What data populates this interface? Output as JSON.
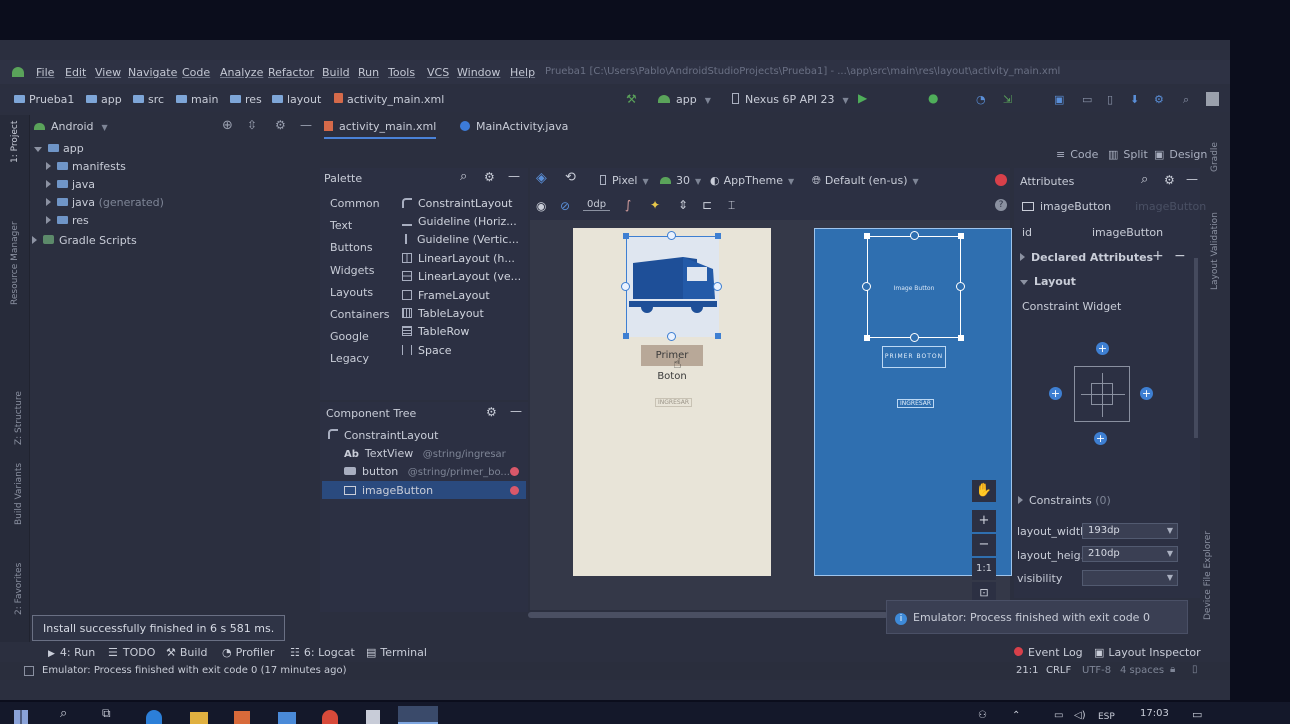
{
  "menu": [
    "File",
    "Edit",
    "View",
    "Navigate",
    "Code",
    "Analyze",
    "Refactor",
    "Build",
    "Run",
    "Tools",
    "VCS",
    "Window",
    "Help"
  ],
  "title": "Prueba1 [C:\\Users\\Pablo\\AndroidStudioProjects\\Prueba1] - ...\\app\\src\\main\\res\\layout\\activity_main.xml",
  "breadcrumbs": [
    "Prueba1",
    "app",
    "src",
    "main",
    "res",
    "layout",
    "activity_main.xml"
  ],
  "run_config": "app",
  "device": "Nexus 6P API 23",
  "project_view": "Android",
  "tabs": [
    "activity_main.xml",
    "MainActivity.java"
  ],
  "view_modes": [
    "Code",
    "Split",
    "Design"
  ],
  "project_tree": [
    {
      "label": "app",
      "level": 0,
      "open": true
    },
    {
      "label": "manifests",
      "level": 1
    },
    {
      "label": "java",
      "level": 1
    },
    {
      "label": "java",
      "suffix": "(generated)",
      "level": 1
    },
    {
      "label": "res",
      "level": 1
    },
    {
      "label": "Gradle Scripts",
      "level": 0
    }
  ],
  "side_tools": [
    "1: Project",
    "Resource Manager",
    "Z: Structure",
    "Build Variants",
    "2: Favorites"
  ],
  "right_tools": [
    "Gradle",
    "Layout Validation",
    "Device File Explorer"
  ],
  "palette": {
    "title": "Palette",
    "categories": [
      "Common",
      "Text",
      "Buttons",
      "Widgets",
      "Layouts",
      "Containers",
      "Google",
      "Legacy"
    ],
    "items": [
      "ConstraintLayout",
      "Guideline (Horiz...",
      "Guideline (Vertic...",
      "LinearLayout (h...",
      "LinearLayout (ve...",
      "FrameLayout",
      "TableLayout",
      "TableRow",
      "Space"
    ]
  },
  "design_toolbar": {
    "device": "Pixel",
    "api": "30",
    "theme": "AppTheme",
    "locale": "Default (en-us)",
    "margin": "0dp"
  },
  "component_tree": {
    "title": "Component Tree",
    "items": [
      {
        "label": "ConstraintLayout",
        "ref": "",
        "level": 0
      },
      {
        "label": "TextView",
        "ref": "@string/ingresar",
        "level": 1
      },
      {
        "label": "button",
        "ref": "@string/primer_bo...",
        "level": 1
      },
      {
        "label": "imageButton",
        "ref": "",
        "level": 1
      }
    ]
  },
  "preview": {
    "button_text": "Primer Boton",
    "textview_text": "INGRESAR",
    "blueprint_image_label": "Image Button",
    "blueprint_button_label": "PRIMER BOTON",
    "blueprint_textview_label": "INGRESAR",
    "zoom_label": "1:1"
  },
  "attributes": {
    "title": "Attributes",
    "component": "imageButton",
    "component_hint": "imageButton",
    "id_label": "id",
    "id_value": "imageButton",
    "declared": "Declared Attributes",
    "layout": "Layout",
    "layout_kind": "Constraint Widget",
    "constraints": "Constraints",
    "constraints_count": "(0)",
    "width_label": "layout_width",
    "width_value": "193dp",
    "height_label": "layout_heig...",
    "height_value": "210dp",
    "visibility_label": "visibility"
  },
  "toast": "Install successfully finished in 6 s 581 ms.",
  "emulator_notice": "Emulator: Process finished with exit code 0",
  "bottom_tools": [
    "4: Run",
    "TODO",
    "Build",
    "Profiler",
    "6: Logcat",
    "Terminal"
  ],
  "bottom_right_tools": [
    "Event Log",
    "Layout Inspector"
  ],
  "status": {
    "message": "Emulator: Process finished with exit code 0 (17 minutes ago)",
    "position": "21:1",
    "line_sep": "CRLF",
    "encoding": "UTF-8",
    "indent": "4 spaces"
  },
  "taskbar": {
    "time": "17:03",
    "lang": "ESP"
  },
  "colors": {
    "accent": "#3e7fd2",
    "blueprint": "#2f6fb0",
    "error": "#d9586a",
    "selection": "#2a4a7e"
  }
}
